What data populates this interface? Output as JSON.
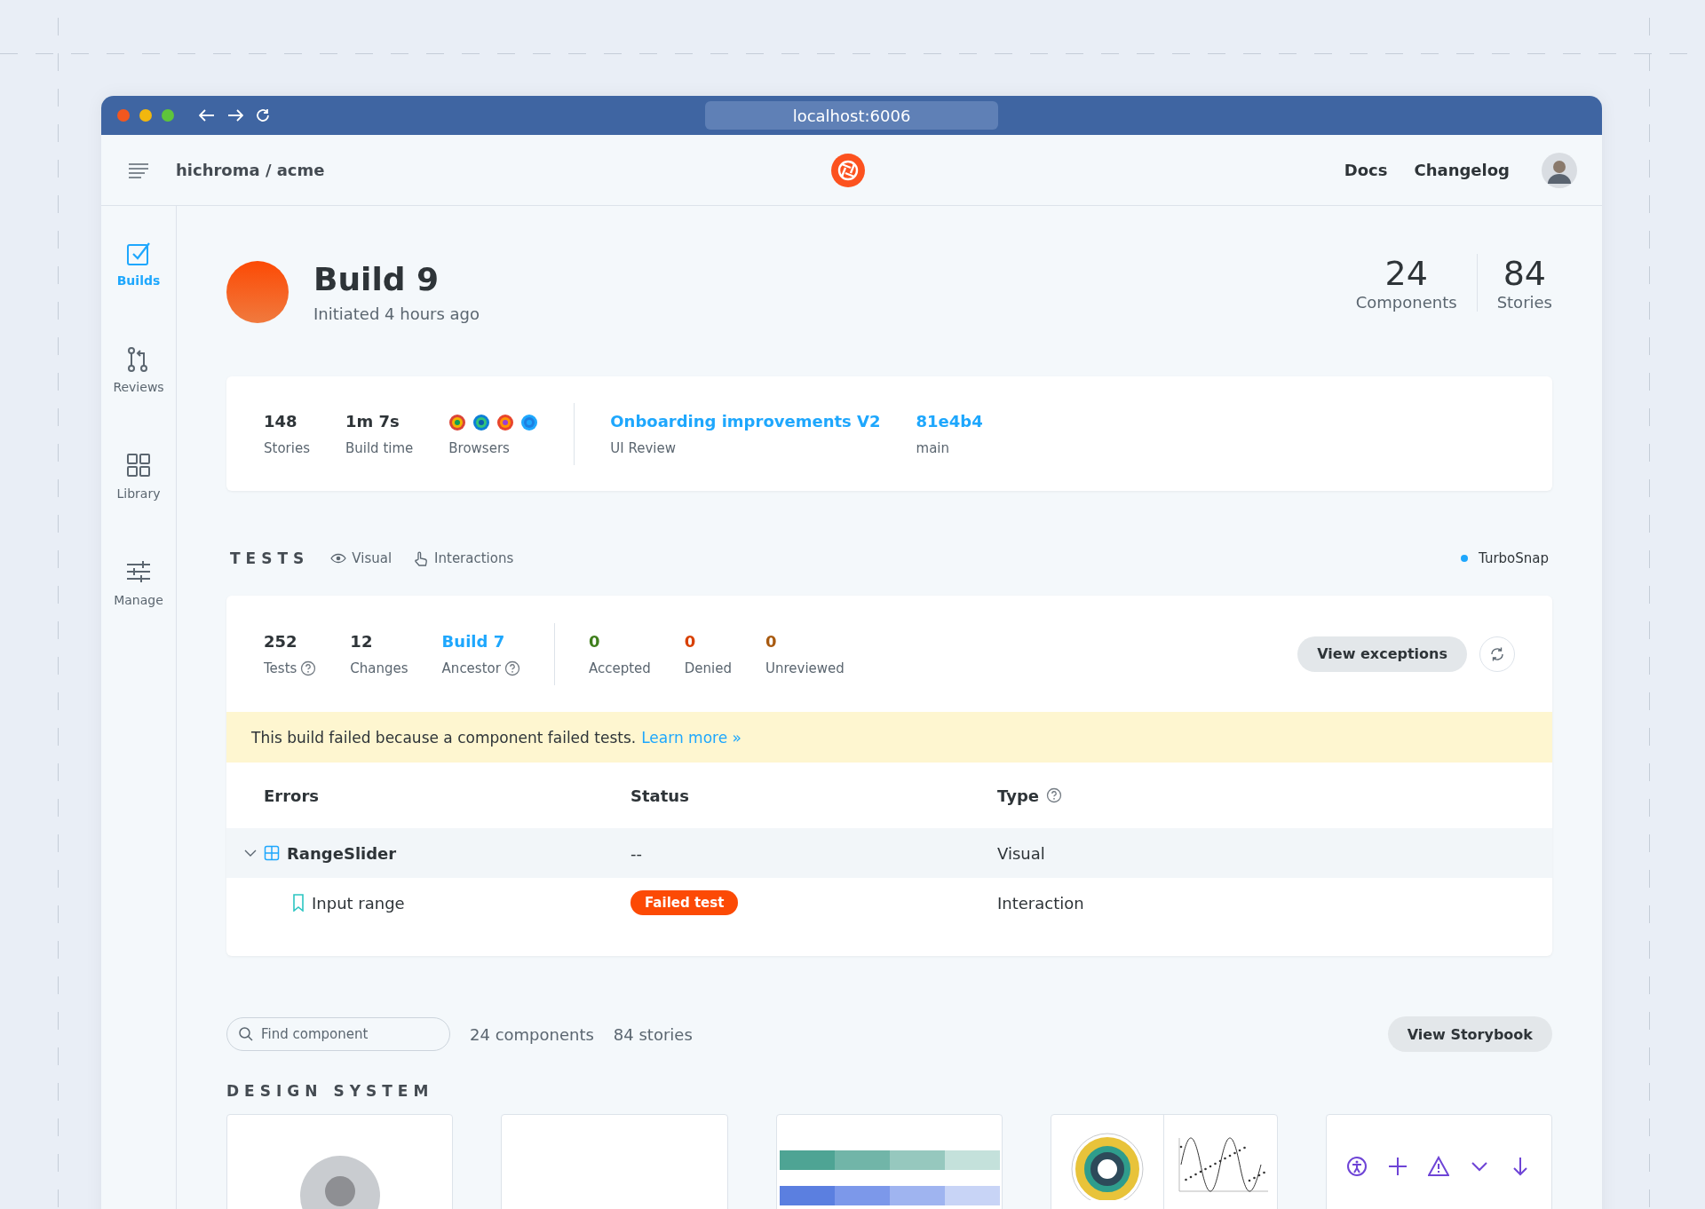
{
  "browser": {
    "url": "localhost:6006"
  },
  "header": {
    "breadcrumb": "hichroma / acme",
    "links": [
      "Docs",
      "Changelog"
    ]
  },
  "sidebar": {
    "items": [
      {
        "label": "Builds",
        "selected": true
      },
      {
        "label": "Reviews",
        "selected": false
      },
      {
        "label": "Library",
        "selected": false
      },
      {
        "label": "Manage",
        "selected": false
      }
    ]
  },
  "build": {
    "title": "Build 9",
    "subtitle": "Initiated 4 hours ago",
    "counts": [
      {
        "value": "24",
        "label": "Components"
      },
      {
        "value": "84",
        "label": "Stories"
      }
    ]
  },
  "summary": {
    "stats": [
      {
        "kind": "plain",
        "value": "148",
        "label": "Stories"
      },
      {
        "kind": "plain",
        "value": "1m 7s",
        "label": "Build time"
      },
      {
        "kind": "browsers",
        "label": "Browsers"
      },
      {
        "kind": "link",
        "value": "Onboarding improvements V2",
        "label": "UI Review"
      },
      {
        "kind": "link",
        "value": "81e4b4",
        "label": "main"
      }
    ]
  },
  "tests": {
    "title": "TESTS",
    "filters": [
      "Visual",
      "Interactions"
    ],
    "turbosnap": "TurboSnap",
    "stats": [
      {
        "kind": "plain",
        "value": "252",
        "label": "Tests",
        "help": true
      },
      {
        "kind": "plain",
        "value": "12",
        "label": "Changes",
        "help": false
      },
      {
        "kind": "link",
        "value": "Build 7",
        "label": "Ancestor",
        "help": true
      }
    ],
    "reviews": [
      {
        "value": "0",
        "label": "Accepted",
        "color": "#3f7f1c"
      },
      {
        "value": "0",
        "label": "Denied",
        "color": "#d84000"
      },
      {
        "value": "0",
        "label": "Unreviewed",
        "color": "#a85a10"
      }
    ],
    "button": "View exceptions",
    "banner": {
      "text": "This build failed because a component failed tests.",
      "link": "Learn more »"
    },
    "table": {
      "columns": [
        {
          "label": "Errors",
          "help": false
        },
        {
          "label": "Status",
          "help": false
        },
        {
          "label": "Type",
          "help": true
        }
      ],
      "rows": [
        {
          "name": "RangeSlider",
          "status": {
            "kind": "text",
            "text": "--"
          },
          "type": "Visual",
          "expanded": true,
          "children": [
            {
              "name": "Input range",
              "status": {
                "kind": "badge",
                "text": "Failed test"
              },
              "type": "Interaction"
            }
          ]
        }
      ]
    }
  },
  "library": {
    "search": {
      "placeholder": "Find component"
    },
    "counts": [
      "24 components",
      "84 stories"
    ],
    "button": "View Storybook",
    "section": "DESIGN SYSTEM",
    "cards": [
      {
        "kind": "avatar"
      },
      {
        "kind": "blank"
      },
      {
        "kind": "palette"
      },
      {
        "kind": "charts"
      },
      {
        "kind": "icons"
      }
    ]
  }
}
